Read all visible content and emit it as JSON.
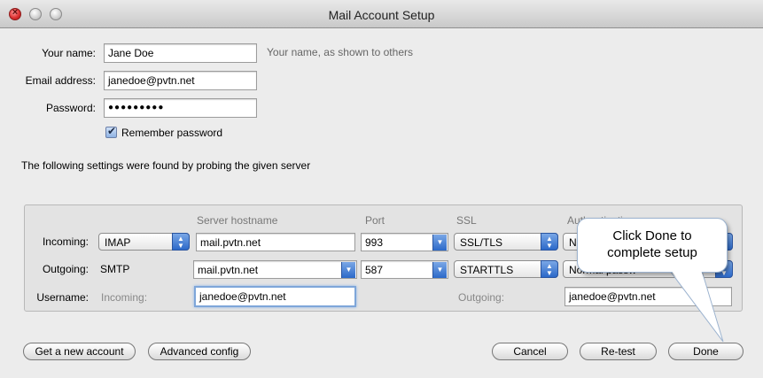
{
  "window": {
    "title": "Mail Account Setup"
  },
  "identity": {
    "name_label": "Your name:",
    "name_value": "Jane Doe",
    "name_hint": "Your name, as shown to others",
    "email_label": "Email address:",
    "email_value": "janedoe@pvtn.net",
    "password_label": "Password:",
    "password_value": "●●●●●●●●●",
    "remember_label": "Remember password"
  },
  "probe_message": "The following settings were found by probing the given server",
  "server": {
    "headers": {
      "hostname": "Server hostname",
      "port": "Port",
      "ssl": "SSL",
      "auth": "Authentication"
    },
    "incoming": {
      "label": "Incoming:",
      "protocol": "IMAP",
      "hostname": "mail.pvtn.net",
      "port": "993",
      "ssl": "SSL/TLS",
      "auth": "No"
    },
    "outgoing": {
      "label": "Outgoing:",
      "protocol": "SMTP",
      "hostname": "mail.pvtn.net",
      "port": "587",
      "ssl": "STARTTLS",
      "auth": "Normal passw"
    },
    "username": {
      "label": "Username:",
      "incoming_label": "Incoming:",
      "incoming_value": "janedoe@pvtn.net",
      "outgoing_label": "Outgoing:",
      "outgoing_value": "janedoe@pvtn.net"
    }
  },
  "buttons": {
    "new_account": "Get a new account",
    "advanced": "Advanced config",
    "cancel": "Cancel",
    "retest": "Re-test",
    "done": "Done"
  },
  "callout": {
    "line1": "Click Done to",
    "line2": "complete setup"
  },
  "icons": {
    "checkbox": "check-icon",
    "select": "updown-arrows-icon",
    "combo": "down-arrow-icon"
  }
}
